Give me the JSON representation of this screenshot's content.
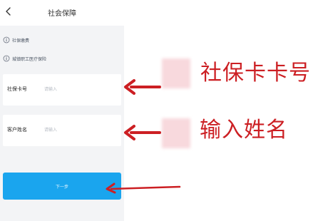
{
  "header": {
    "title": "社会保障",
    "back_icon": "chevron-left-icon"
  },
  "notices": [
    {
      "icon": "info-circle-icon",
      "text": "社保缴费"
    },
    {
      "icon": "info-circle-icon",
      "text": "城镇职工医疗保险"
    }
  ],
  "form": {
    "card_number": {
      "label": "社保卡号",
      "placeholder": "请输入",
      "value": ""
    },
    "customer_name": {
      "label": "客户姓名",
      "placeholder": "请输入",
      "value": ""
    }
  },
  "buttons": {
    "next_label": "下一步"
  },
  "annotations": {
    "card_label": "社保卡卡号",
    "name_label": "输入姓名",
    "color": "#cc1f23",
    "redaction_color": "#f8d9dd"
  },
  "colors": {
    "primary_button": "#1aa5ee",
    "page_background": "#f3f4f6"
  }
}
